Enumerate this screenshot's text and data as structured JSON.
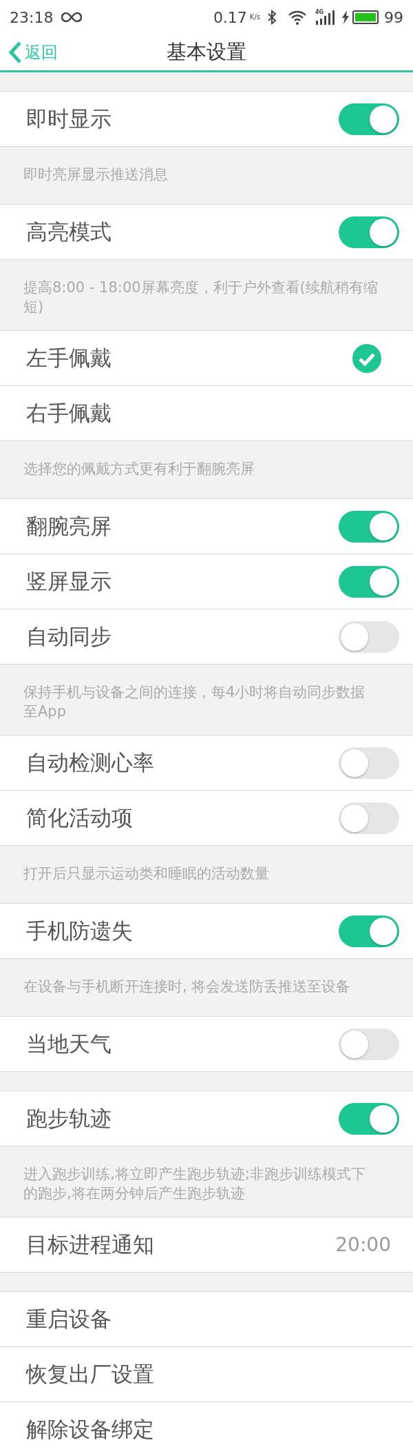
{
  "status_bar": {
    "time": "23:18",
    "speed": "0.17",
    "speed_unit": "K/s",
    "network": "4G",
    "battery": "99"
  },
  "nav": {
    "back": "返回",
    "title": "基本设置"
  },
  "groups": [
    {
      "rows": [
        {
          "kind": "toggle",
          "label": "即时显示",
          "on": true
        }
      ],
      "note": "即时亮屏显示推送消息"
    },
    {
      "rows": [
        {
          "kind": "toggle",
          "label": "高亮模式",
          "on": true
        }
      ],
      "note": "提高8:00 - 18:00屏幕亮度，利于户外查看(续航稍有缩短)"
    },
    {
      "rows": [
        {
          "kind": "choice",
          "label": "左手佩戴",
          "selected": true
        },
        {
          "kind": "choice",
          "label": "右手佩戴",
          "selected": false
        }
      ],
      "note": "选择您的佩戴方式更有利于翻腕亮屏"
    },
    {
      "rows": [
        {
          "kind": "toggle",
          "label": "翻腕亮屏",
          "on": true
        },
        {
          "kind": "toggle",
          "label": "竖屏显示",
          "on": true
        },
        {
          "kind": "toggle",
          "label": "自动同步",
          "on": false
        }
      ],
      "note": "保持手机与设备之间的连接，每4小时将自动同步数据至App"
    },
    {
      "rows": [
        {
          "kind": "toggle",
          "label": "自动检测心率",
          "on": false
        },
        {
          "kind": "toggle",
          "label": "简化活动项",
          "on": false
        }
      ],
      "note": "打开后只显示运动类和睡眠的活动数量"
    },
    {
      "rows": [
        {
          "kind": "toggle",
          "label": "手机防遗失",
          "on": true
        }
      ],
      "note": "在设备与手机断开连接时, 将会发送防丢推送至设备"
    },
    {
      "rows": [
        {
          "kind": "toggle",
          "label": "当地天气",
          "on": false
        }
      ]
    },
    {
      "rows": [
        {
          "kind": "toggle",
          "label": "跑步轨迹",
          "on": true
        }
      ],
      "note": "进入跑步训练,将立即产生跑步轨迹;非跑步训练模式下的跑步,将在两分钟后产生跑步轨迹"
    },
    {
      "rows": [
        {
          "kind": "value",
          "label": "目标进程通知",
          "value": "20:00"
        }
      ]
    },
    {
      "rows": [
        {
          "kind": "action",
          "label": "重启设备"
        },
        {
          "kind": "action",
          "label": "恢复出厂设置"
        },
        {
          "kind": "action",
          "label": "解除设备绑定"
        }
      ]
    }
  ]
}
